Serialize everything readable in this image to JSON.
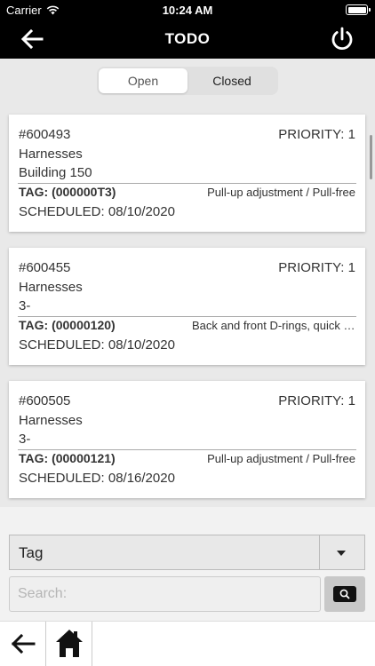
{
  "status_bar": {
    "carrier": "Carrier",
    "time": "10:24 AM"
  },
  "nav": {
    "title": "TODO",
    "back_icon": "arrow-left-icon",
    "power_icon": "power-icon"
  },
  "segments": [
    {
      "label": "Open",
      "selected": true
    },
    {
      "label": "Closed",
      "selected": false
    }
  ],
  "cards": [
    {
      "id": "#600493",
      "priority": "PRIORITY: 1",
      "type": "Harnesses",
      "location": "Building 150",
      "tag": "TAG: (000000T3)",
      "description": "Pull-up adjustment / Pull-free",
      "scheduled": "SCHEDULED: 08/10/2020"
    },
    {
      "id": "#600455",
      "priority": "PRIORITY: 1",
      "type": "Harnesses",
      "location": "3-",
      "tag": "TAG: (00000120)",
      "description": "Back and front D-rings, quick c...",
      "scheduled": "SCHEDULED: 08/10/2020"
    },
    {
      "id": "#600505",
      "priority": "PRIORITY: 1",
      "type": "Harnesses",
      "location": "3-",
      "tag": "TAG: (00000121)",
      "description": "Pull-up adjustment / Pull-free",
      "scheduled": "SCHEDULED: 08/16/2020"
    }
  ],
  "filter": {
    "selected": "Tag",
    "caret_icon": "caret-down-icon"
  },
  "search": {
    "placeholder": "Search:",
    "value": "",
    "button_icon": "search-icon"
  },
  "tabbar": {
    "back_icon": "arrow-left-icon",
    "home_icon": "home-icon"
  }
}
